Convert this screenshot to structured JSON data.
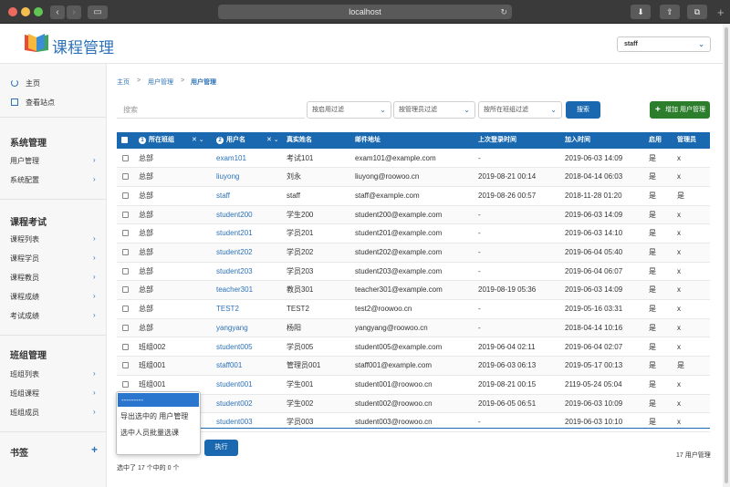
{
  "browser": {
    "url": "localhost"
  },
  "header": {
    "brand": "课程管理",
    "user": "staff"
  },
  "sidebar": {
    "top_items": [
      {
        "label": "主页"
      },
      {
        "label": "查看站点"
      }
    ],
    "sections": [
      {
        "heading": "系统管理",
        "items": [
          "用户管理",
          "系统配置"
        ]
      },
      {
        "heading": "课程考试",
        "items": [
          "课程列表",
          "课程学员",
          "课程教员",
          "课程成绩",
          "考试成绩"
        ]
      },
      {
        "heading": "班组管理",
        "items": [
          "班组列表",
          "班组课程",
          "班组成员"
        ]
      },
      {
        "heading": "书签",
        "items": []
      }
    ]
  },
  "breadcrumb": {
    "home": "主页",
    "app": "用户管理",
    "current": "用户管理",
    "sep": ">"
  },
  "filters": {
    "search_placeholder": "搜索",
    "enabled": "按启用过滤",
    "admin": "按管理员过滤",
    "group": "按所在班组过滤",
    "search_button": "搜索",
    "add_button": "增加 用户管理"
  },
  "table": {
    "columns": {
      "group": "所在班组",
      "group_sort": "1",
      "username": "用户名",
      "username_sort": "2",
      "realname": "真实姓名",
      "email": "邮件地址",
      "last_login": "上次登录时间",
      "joined": "加入时间",
      "enabled": "启用",
      "admin": "管理员"
    },
    "rows": [
      [
        "总部",
        "exam101",
        "考试101",
        "exam101@example.com",
        "-",
        "2019-06-03 14:09",
        "是",
        "x"
      ],
      [
        "总部",
        "liuyong",
        "刘永",
        "liuyong@roowoo.cn",
        "2019-08-21 00:14",
        "2018-04-14 06:03",
        "是",
        "x"
      ],
      [
        "总部",
        "staff",
        "staff",
        "staff@example.com",
        "2019-08-26 00:57",
        "2018-11-28 01:20",
        "是",
        "是"
      ],
      [
        "总部",
        "student200",
        "学生200",
        "student200@example.com",
        "-",
        "2019-06-03 14:09",
        "是",
        "x"
      ],
      [
        "总部",
        "student201",
        "学员201",
        "student201@example.com",
        "-",
        "2019-06-03 14:10",
        "是",
        "x"
      ],
      [
        "总部",
        "student202",
        "学员202",
        "student202@example.com",
        "-",
        "2019-06-04 05:40",
        "是",
        "x"
      ],
      [
        "总部",
        "student203",
        "学员203",
        "student203@example.com",
        "-",
        "2019-06-04 06:07",
        "是",
        "x"
      ],
      [
        "总部",
        "teacher301",
        "教员301",
        "teacher301@example.com",
        "2019-08-19 05:36",
        "2019-06-03 14:09",
        "是",
        "x"
      ],
      [
        "总部",
        "TEST2",
        "TEST2",
        "test2@roowoo.cn",
        "-",
        "2019-05-16 03:31",
        "是",
        "x"
      ],
      [
        "总部",
        "yangyang",
        "杨阳",
        "yangyang@roowoo.cn",
        "-",
        "2018-04-14 10:16",
        "是",
        "x"
      ],
      [
        "班组002",
        "student005",
        "学员005",
        "student005@example.com",
        "2019-06-04 02:11",
        "2019-06-04 02:07",
        "是",
        "x"
      ],
      [
        "班组001",
        "staff001",
        "管理员001",
        "staff001@example.com",
        "2019-06-03 06:13",
        "2019-05-17 00:13",
        "是",
        "是"
      ],
      [
        "班组001",
        "student001",
        "学生001",
        "student001@roowoo.cn",
        "2019-08-21 00:15",
        "2119-05-24 05:04",
        "是",
        "x"
      ],
      [
        "",
        "student002",
        "学生002",
        "student002@roowoo.cn",
        "2019-06-05 06:51",
        "2019-06-03 10:09",
        "是",
        "x"
      ],
      [
        "",
        "student003",
        "学员003",
        "student003@roowoo.cn",
        "-",
        "2019-06-03 10:10",
        "是",
        "x"
      ]
    ]
  },
  "actions": {
    "placeholder": "---------",
    "options": [
      "导出选中的 用户管理",
      "选中人员批量选课"
    ],
    "execute": "执行"
  },
  "selection": "选中了 17 个中的 0 个",
  "total": "17 用户管理"
}
